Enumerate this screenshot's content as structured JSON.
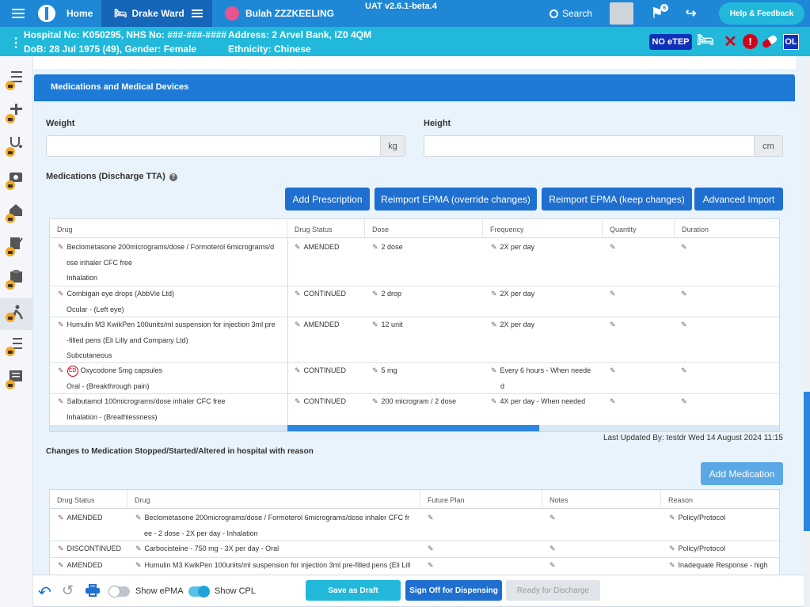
{
  "topbar": {
    "home": "Home",
    "ward": "Drake Ward",
    "patient_name": "Bulah ZZZKEELING",
    "version": "UAT v2.6.1-beta.4",
    "search": "Search",
    "flag_count": "6",
    "help": "Help & Feedback"
  },
  "patient": {
    "hospital_nhs": "Hospital No: K050295, NHS No: ###-###-####",
    "dob_gender": "DoB: 28 Jul 1975 (49), Gender: Female",
    "address": "Address: 2 Arvel Bank, IZ0 4QM",
    "ethnicity": "Ethnicity: Chinese",
    "etep": "NO eTEP",
    "ol": "OL"
  },
  "panel": {
    "title": "Medications and Medical Devices",
    "weight_label": "Weight",
    "weight_unit": "kg",
    "height_label": "Height",
    "height_unit": "cm",
    "meds_label": "Medications (Discharge TTA)",
    "btn_add_prescription": "Add Prescription",
    "btn_reimport_override": "Reimport EPMA (override changes)",
    "btn_reimport_keep": "Reimport EPMA (keep changes)",
    "btn_advanced_import": "Advanced Import",
    "last_updated": "Last Updated By: testdr Wed 14 August 2024 11:15",
    "changes_label": "Changes to Medication Stopped/Started/Altered in hospital with reason",
    "btn_add_medication": "Add Medication"
  },
  "meds_table": {
    "headers": [
      "Drug",
      "Drug Status",
      "Dose",
      "Frequency",
      "Quantity",
      "Duration"
    ],
    "rows": [
      {
        "drug1": "Beclometasone 200micrograms/dose / Formoterol 6micrograms/d",
        "drug2": "ose inhaler CFC free",
        "route": "Inhalation",
        "status": "AMENDED",
        "dose": "2 dose",
        "freq1": "2X per day",
        "freq2": ""
      },
      {
        "drug1": "Combigan eye drops (AbbVie Ltd)",
        "drug2": "",
        "route": "Ocular - (Left eye)",
        "status": "CONTINUED",
        "dose": "2 drop",
        "freq1": "2X per day",
        "freq2": ""
      },
      {
        "drug1": "Humulin M3 KwikPen 100units/ml suspension for injection 3ml pre",
        "drug2": "-filled pens (Eli Lilly and Company Ltd)",
        "route": "Subcutaneous",
        "status": "AMENDED",
        "dose": "12 unit",
        "freq1": "2X per day",
        "freq2": ""
      },
      {
        "drug1": "Oxycodone 5mg capsules",
        "cd": "CD",
        "drug2": "",
        "route": "Oral - (Breakthrough pain)",
        "status": "CONTINUED",
        "dose": "5 mg",
        "freq1": "Every 6 hours - When neede",
        "freq2": "d"
      },
      {
        "drug1": "Salbutamol 100micrograms/dose inhaler CFC free",
        "drug2": "",
        "route": "Inhalation - (Breathlessness)",
        "status": "CONTINUED",
        "dose": "200 microgram / 2 dose",
        "freq1": "4X per day - When needed",
        "freq2": ""
      }
    ]
  },
  "changes_table": {
    "headers": [
      "Drug Status",
      "Drug",
      "Future Plan",
      "Notes",
      "Reason"
    ],
    "rows": [
      {
        "status": "AMENDED",
        "drug1": "Beclometasone 200micrograms/dose / Formoterol 6micrograms/dose inhaler CFC fr",
        "drug2": "ee - 2 dose - 2X per day - Inhalation",
        "reason": "Policy/Protocol"
      },
      {
        "status": "DISCONTINUED",
        "drug1": "Carbocisteine - 750 mg - 3X per day - Oral",
        "drug2": "",
        "reason": "Policy/Protocol"
      },
      {
        "status": "AMENDED",
        "drug1": "Humulin M3 KwikPen 100units/ml suspension for injection 3ml pre-filled pens (Eli Lill",
        "drug2": "",
        "reason": "Inadequate Response - high"
      }
    ]
  },
  "bottombar": {
    "show_epma": "Show ePMA",
    "show_cpl": "Show CPL",
    "save_draft": "Save as Draft",
    "sign_off": "Sign Off for Dispensing",
    "ready": "Ready for Discharge"
  },
  "colors": {
    "primary": "#1e88d6",
    "accent": "#21b8d9",
    "button": "#1e6fcf"
  }
}
